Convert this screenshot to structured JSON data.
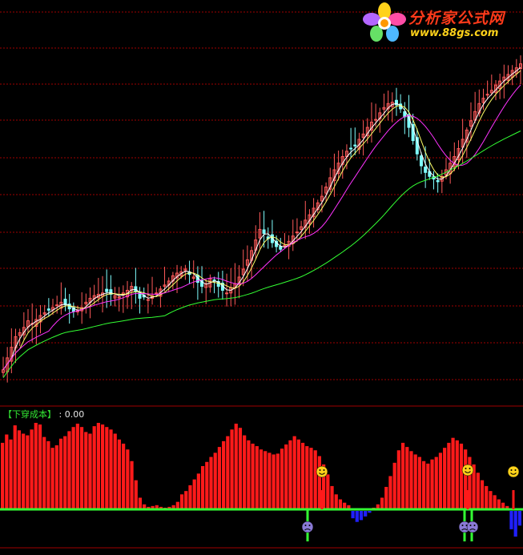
{
  "logo": {
    "brand_cn": "分析家公式网",
    "url": "www.88gs.com"
  },
  "indicator": {
    "name": "【下穿成本】",
    "separator": ":",
    "value": "0.00"
  },
  "colors": {
    "background": "#000000",
    "grid": "#a00000",
    "candle_up": "#ff5a5a",
    "candle_down": "#80ffff",
    "ma_short": "#ffffff",
    "ma_mid": "#ffff66",
    "ma_long": "#ff33ff",
    "ma_longest": "#33ff33",
    "hist_positive": "#ff1a1a",
    "hist_negative": "#2020ff",
    "zero_line": "#33ff33"
  },
  "chart_data": [
    {
      "type": "candlestick",
      "series": [
        {
          "name": "price",
          "color": "#ff5a5a",
          "values": [
            56,
            60,
            63,
            66,
            68,
            70,
            73,
            75,
            76,
            76,
            76,
            77,
            78,
            79,
            80,
            81,
            81,
            82,
            82,
            81,
            77,
            73,
            71,
            70,
            70,
            71,
            72,
            73,
            74,
            75,
            76,
            78,
            81,
            84,
            87,
            90,
            92,
            94,
            96,
            98,
            100,
            102,
            104,
            105,
            106,
            106,
            106,
            106,
            105,
            104,
            101,
            98,
            95,
            90,
            85,
            82,
            83,
            86,
            91,
            97,
            103,
            110,
            117,
            124,
            131,
            139,
            147,
            156,
            164,
            170,
            174,
            176,
            176,
            174,
            171,
            166,
            159,
            152,
            145,
            139,
            134,
            131,
            129,
            129,
            130,
            132,
            134,
            136,
            137,
            137,
            135,
            131,
            125,
            119,
            113,
            108,
            106,
            107,
            109,
            111,
            113,
            116,
            119,
            122,
            126,
            131,
            137,
            143,
            150,
            157,
            164,
            172,
            180,
            188,
            196,
            204,
            212,
            220,
            228,
            236,
            244,
            252,
            260,
            268,
            276,
            284
          ]
        },
        {
          "name": "ma_short",
          "color": "#ffffff",
          "values": [
            56,
            60,
            63,
            66,
            68,
            70,
            73,
            75,
            76,
            76,
            76,
            77,
            78,
            79,
            80,
            81,
            81,
            82,
            82,
            81,
            77,
            73,
            71,
            70,
            70,
            71,
            72,
            73,
            74,
            75,
            76,
            78,
            81,
            84,
            87,
            90,
            92,
            94,
            96,
            98,
            100,
            102,
            104,
            105,
            106,
            106,
            106,
            106,
            105,
            104,
            101,
            98,
            95,
            90,
            85,
            82,
            83,
            86,
            91,
            97,
            103,
            110,
            117,
            124,
            131,
            139,
            147,
            156,
            164,
            170,
            174,
            176,
            176,
            174,
            171,
            166,
            159,
            152,
            145,
            139,
            134,
            131,
            129,
            129,
            130,
            132,
            134,
            136,
            137,
            137,
            135,
            131,
            125,
            119,
            113,
            108,
            106,
            107,
            109,
            111,
            113,
            116,
            119,
            122,
            126,
            131,
            137,
            143,
            150,
            157,
            164,
            172,
            180,
            188,
            196,
            204,
            212,
            220,
            228,
            236,
            244,
            252,
            260,
            268,
            276,
            284
          ]
        },
        {
          "name": "ma_mid",
          "color": "#ffff66",
          "values": [
            56,
            60,
            63,
            66,
            68,
            70,
            73,
            75,
            76,
            76,
            76,
            77,
            78,
            79,
            80,
            81,
            81,
            82,
            82,
            81,
            77,
            73,
            71,
            70,
            70,
            71,
            72,
            73,
            74,
            75,
            76,
            78,
            81,
            84,
            87,
            90,
            92,
            94,
            96,
            98,
            100,
            102,
            104,
            105,
            106,
            106,
            106,
            106,
            105,
            104,
            101,
            98,
            95,
            90,
            85,
            82,
            83,
            86,
            91,
            97,
            103,
            110,
            117,
            124,
            131,
            139,
            147,
            156,
            164,
            170,
            174,
            176,
            176,
            174,
            171,
            166,
            159,
            152,
            145,
            139,
            134,
            131,
            129,
            129,
            130,
            132,
            134,
            136,
            137,
            137,
            135,
            131,
            125,
            119,
            113,
            108,
            106,
            107,
            109,
            111,
            113,
            116,
            119,
            122,
            126,
            131,
            137,
            143,
            150,
            157,
            164,
            172,
            180,
            188,
            196,
            204,
            212,
            220,
            228,
            236,
            244,
            252,
            260,
            268,
            276,
            284
          ]
        },
        {
          "name": "ma_long",
          "color": "#ff33ff",
          "values": [
            56,
            60,
            63,
            66,
            68,
            70,
            73,
            75,
            76,
            76,
            76,
            77,
            78,
            79,
            80,
            81,
            81,
            82,
            82,
            81,
            77,
            73,
            71,
            70,
            70,
            71,
            72,
            73,
            74,
            75,
            76,
            78,
            81,
            84,
            87,
            90,
            92,
            94,
            96,
            98,
            100,
            102,
            104,
            105,
            106,
            106,
            106,
            106,
            105,
            104,
            101,
            98,
            95,
            90,
            85,
            82,
            83,
            86,
            91,
            97,
            103,
            110,
            117,
            124,
            131,
            139,
            147,
            156,
            164,
            170,
            174,
            176,
            176,
            174,
            171,
            166,
            159,
            152,
            145,
            139,
            134,
            131,
            129,
            129,
            130,
            132,
            134,
            136,
            137,
            137,
            135,
            131,
            125,
            119,
            113,
            108,
            106,
            107,
            109,
            111,
            113,
            116,
            119,
            122,
            126,
            131,
            137,
            143,
            150,
            157,
            164,
            172,
            180,
            188,
            196,
            204,
            212,
            220,
            228,
            236,
            244,
            252,
            260,
            268,
            276,
            284
          ]
        },
        {
          "name": "ma_longest",
          "color": "#33ff33",
          "values": [
            56,
            60,
            63,
            66,
            68,
            70,
            73,
            75,
            76,
            76,
            76,
            77,
            78,
            79,
            80,
            81,
            81,
            82,
            82,
            81,
            77,
            73,
            71,
            70,
            70,
            71,
            72,
            73,
            74,
            75,
            76,
            78,
            81,
            84,
            87,
            90,
            92,
            94,
            96,
            98,
            100,
            102,
            104,
            105,
            106,
            106,
            106,
            106,
            105,
            104,
            101,
            98,
            95,
            90,
            85,
            82,
            83,
            86,
            91,
            97,
            103,
            110,
            117,
            124,
            131,
            139,
            147,
            156,
            164,
            170,
            174,
            176,
            176,
            174,
            171,
            166,
            159,
            152,
            145,
            139,
            134,
            131,
            129,
            129,
            130,
            132,
            134,
            136,
            137,
            137,
            135,
            131,
            125,
            119,
            113,
            108,
            106,
            107,
            109,
            111,
            113,
            116,
            119,
            122,
            126,
            131,
            137,
            143,
            150,
            157,
            164,
            172,
            180,
            188,
            196,
            204,
            212,
            220,
            228,
            236,
            244,
            252,
            260,
            268,
            276,
            284
          ]
        }
      ],
      "close": [
        45,
        54,
        62,
        70,
        73,
        77,
        82,
        80,
        83,
        86,
        88,
        90,
        92,
        94,
        96,
        94,
        91,
        89,
        90,
        92,
        96,
        99,
        101,
        102,
        103,
        104,
        102,
        101,
        100,
        103,
        105,
        108,
        104,
        99,
        100,
        98,
        101,
        103,
        106,
        109,
        112,
        116,
        118,
        119,
        121,
        117,
        115,
        111,
        108,
        110,
        114,
        112,
        108,
        105,
        103,
        107,
        110,
        115,
        121,
        128,
        135,
        143,
        151,
        148,
        144,
        141,
        138,
        136,
        139,
        142,
        146,
        149,
        153,
        158,
        162,
        167,
        171,
        176,
        183,
        190,
        196,
        201,
        206,
        210,
        212,
        214,
        219,
        223,
        228,
        232,
        234,
        239,
        243,
        246,
        247,
        245,
        242,
        236,
        228,
        218,
        208,
        199,
        194,
        191,
        189,
        187,
        191,
        196,
        201,
        206,
        212,
        219,
        226,
        233,
        240,
        246,
        250,
        253,
        256,
        260,
        263,
        266,
        268,
        271,
        273,
        276
      ],
      "ma_short": [],
      "ma_mid": [],
      "ma_long": [],
      "ma_longest": [],
      "histogram": [
        80,
        90,
        84,
        101,
        95,
        91,
        89,
        96,
        104,
        102,
        87,
        82,
        74,
        77,
        85,
        88,
        94,
        99,
        103,
        99,
        93,
        91,
        100,
        104,
        102,
        99,
        96,
        91,
        84,
        79,
        72,
        58,
        35,
        14,
        6,
        3,
        4,
        5,
        3,
        2,
        3,
        5,
        9,
        18,
        22,
        29,
        36,
        43,
        52,
        57,
        63,
        68,
        75,
        82,
        88,
        96,
        103,
        98,
        89,
        83,
        79,
        76,
        72,
        70,
        68,
        66,
        67,
        73,
        78,
        83,
        88,
        84,
        80,
        76,
        74,
        71,
        64,
        54,
        42,
        28,
        18,
        12,
        8,
        5,
        -4,
        -6,
        -5,
        -3,
        -1,
        2,
        6,
        14,
        27,
        40,
        56,
        71,
        80,
        75,
        70,
        66,
        63,
        58,
        55,
        60,
        63,
        68,
        74,
        80,
        86,
        83,
        79,
        72,
        63,
        54,
        44,
        35,
        28,
        22,
        17,
        12,
        8,
        4,
        -10,
        -14,
        -8
      ]
    }
  ]
}
